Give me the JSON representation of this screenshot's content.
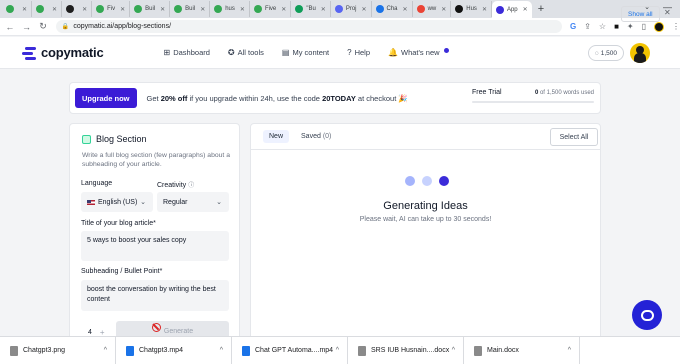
{
  "browser": {
    "tabs": [
      {
        "label": "",
        "color": "#34a853"
      },
      {
        "label": "",
        "color": "#34a853"
      },
      {
        "label": "",
        "color": "#1f1f1f"
      },
      {
        "label": "Fiv",
        "color": "#34a853"
      },
      {
        "label": "Buil",
        "color": "#34a853"
      },
      {
        "label": "Buil",
        "color": "#34a853"
      },
      {
        "label": "hus",
        "color": "#34a853"
      },
      {
        "label": "Five",
        "color": "#34a853"
      },
      {
        "label": "\"Bu",
        "color": "#0f9d58"
      },
      {
        "label": "Proj",
        "color": "#5865f2"
      },
      {
        "label": "Cha",
        "color": "#1a73e8"
      },
      {
        "label": "ww",
        "color": "#ea4335"
      },
      {
        "label": "Hus",
        "color": "#111111"
      },
      {
        "label": "App",
        "color": "#3b2bd9",
        "active": true
      }
    ],
    "new_tab": "+",
    "url": "copymatic.ai/app/blog-sections/"
  },
  "header": {
    "logo": "copymatic",
    "nav": [
      {
        "label": "Dashboard",
        "icon": "grid-icon"
      },
      {
        "label": "All tools",
        "icon": "tools-icon"
      },
      {
        "label": "My content",
        "icon": "document-icon"
      },
      {
        "label": "Help",
        "icon": "help-icon"
      },
      {
        "label": "What's new",
        "icon": "bell-icon"
      }
    ],
    "credits": "1,500"
  },
  "promo": {
    "button": "Upgrade now",
    "text_prefix": "Get ",
    "text_bold": "20% off",
    "text_mid": " if you upgrade within 24h, use the code ",
    "code": "20TODAY",
    "text_suffix": " at checkout",
    "trial_label": "Free Trial",
    "used": "0",
    "of_text": " of 1,500 words used"
  },
  "form": {
    "title": "Blog Section",
    "description": "Write a full blog section (few paragraphs) about a subheading of your article.",
    "language_label": "Language",
    "language_value": "English (US)",
    "creativity_label": "Creativity",
    "creativity_value": "Regular",
    "article_title_label": "Title of your blog article*",
    "article_title_value": "5 ways to boost your sales copy",
    "subheading_label": "Subheading / Bullet Point*",
    "subheading_value": "boost the conversation by writing the best content",
    "quantity": "4",
    "generate_label": "Generate"
  },
  "results": {
    "tab_new": "New",
    "tab_saved": "Saved",
    "saved_count": "(0)",
    "select_all": "Select All",
    "loading_title": "Generating Ideas",
    "loading_sub": "Please wait, AI can take up to 30 seconds!",
    "dot_colors": [
      "#a5b4fc",
      "#c7d2fe",
      "#3b2bd9"
    ]
  },
  "downloads": [
    {
      "name": "Chatgpt3.png",
      "color": "#8a8a8a"
    },
    {
      "name": "Chatgpt3.mp4",
      "color": "#1a73e8"
    },
    {
      "name": "Chat GPT Automa....mp4",
      "color": "#1a73e8"
    },
    {
      "name": "SRS IUB Husnain....docx",
      "color": "#8a8a8a"
    },
    {
      "name": "Main.docx",
      "color": "#8a8a8a"
    }
  ],
  "show_all": "Show all"
}
